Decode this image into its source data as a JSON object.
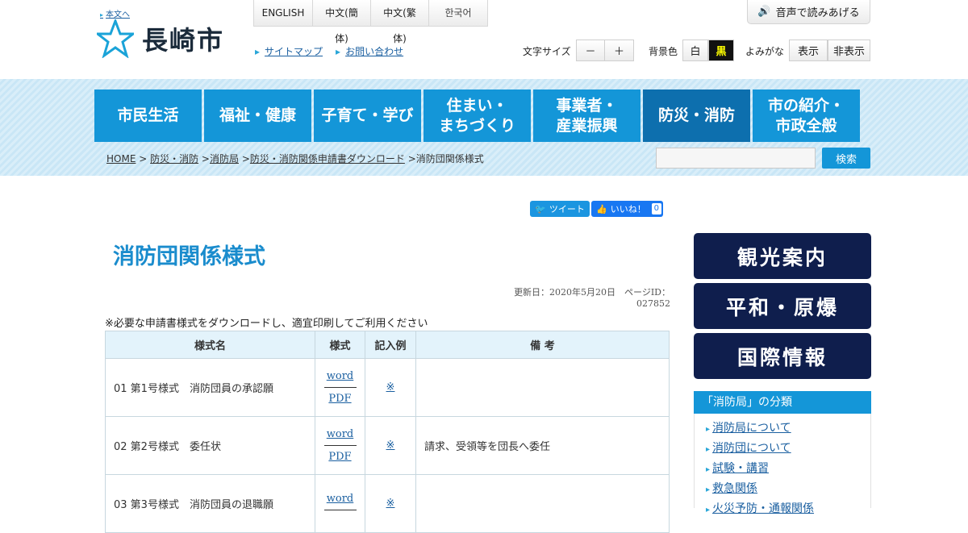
{
  "header": {
    "skip_link": "本文へ",
    "logo_text": "長崎市",
    "languages": [
      "ENGLISH",
      "中文(簡体)",
      "中文(繁体)",
      "한국어"
    ],
    "links": [
      "サイトマップ",
      "お問い合わせ"
    ],
    "voice_button": "音声で読みあげる",
    "font_size_label": "文字サイズ",
    "font_minus": "－",
    "font_plus": "＋",
    "bg_label": "背景色",
    "bg_white": "白",
    "bg_black": "黒",
    "yomigana_label": "よみがな",
    "yomigana_show": "表示",
    "yomigana_hide": "非表示"
  },
  "nav": [
    "市民生活",
    "福祉・健康",
    "子育て・学び",
    "住まい・\nまちづくり",
    "事業者・\n産業振興",
    "防災・消防",
    "市の紹介・\n市政全般"
  ],
  "breadcrumb": {
    "items": [
      "HOME",
      "防災・消防",
      "消防局",
      "防災・消防関係申請書ダウンロード"
    ],
    "current": "消防団関係様式"
  },
  "search": {
    "button": "検索"
  },
  "social": {
    "tweet": "ツイート",
    "like": "いいね！",
    "like_count": "0"
  },
  "page": {
    "title": "消防団関係様式",
    "updated": "更新日：2020年5月20日　ページID：027852",
    "note": "※必要な申請書様式をダウンロードし、適宜印刷してご利用ください"
  },
  "table": {
    "headers": [
      "様式名",
      "様式",
      "記入例",
      "備 考"
    ],
    "rows": [
      {
        "name": "01 第1号様式　消防団員の承認願",
        "word": "word",
        "pdf": "PDF",
        "example": "※",
        "remarks": ""
      },
      {
        "name": "02 第2号様式　委任状",
        "word": "word",
        "pdf": "PDF",
        "example": "※",
        "remarks": "請求、受領等を団長へ委任"
      },
      {
        "name": "03 第3号様式　消防団員の退職願",
        "word": "word",
        "pdf": "",
        "example": "※",
        "remarks": ""
      }
    ]
  },
  "sidebar": {
    "buttons": [
      "観光案内",
      "平和・原爆",
      "国際情報"
    ],
    "category_title": "「消防局」の分類",
    "category_items": [
      "消防局について",
      "消防団について",
      "試験・講習",
      "救急関係",
      "火災予防・通報関係"
    ]
  }
}
